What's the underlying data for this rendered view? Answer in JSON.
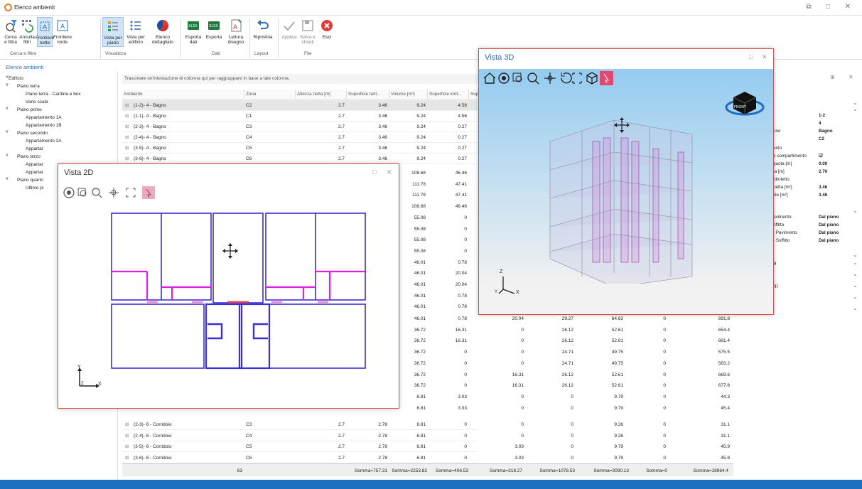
{
  "app": {
    "title": "Elenco ambienti"
  },
  "ribbon": {
    "buttons": [
      {
        "label": "Cerca e filtra",
        "icon": "search-filter-icon"
      },
      {
        "label": "Annulla filtri",
        "icon": "clear-filter-icon"
      },
      {
        "label": "Frontiere nette",
        "icon": "net-boundary-icon"
      },
      {
        "label": "Frontiere lorde",
        "icon": "gross-boundary-icon"
      },
      {
        "label": "Vista per piano",
        "icon": "floor-view-icon"
      },
      {
        "label": "Vista per edificio",
        "icon": "building-view-icon"
      },
      {
        "label": "Elenco dettagliato",
        "icon": "pie-chart-icon"
      },
      {
        "label": "Esporta dati",
        "icon": "xlsx-icon"
      },
      {
        "label": "Esporta",
        "icon": "xlsx-icon"
      },
      {
        "label": "Lettura disegno",
        "icon": "drawing-read-icon"
      },
      {
        "label": "Ripristina",
        "icon": "undo-icon"
      },
      {
        "label": "Applica",
        "icon": "check-icon"
      },
      {
        "label": "Salva e chiudi",
        "icon": "save-close-icon"
      },
      {
        "label": "Esci",
        "icon": "exit-icon"
      }
    ],
    "groups": [
      "Cerca e filtra",
      "Visualizza",
      "Dati",
      "Layout",
      "File"
    ]
  },
  "left_panel": {
    "title": "Elenco ambienti"
  },
  "tree": [
    {
      "label": "Edificio",
      "level": 0,
      "exp": "v"
    },
    {
      "label": "Piano terra",
      "level": 1,
      "exp": "v"
    },
    {
      "label": "Piano terra - Cantine e box",
      "level": 2
    },
    {
      "label": "Vano scala",
      "level": 2
    },
    {
      "label": "Piano primo",
      "level": 1,
      "exp": "v"
    },
    {
      "label": "Appartamento 1A",
      "level": 2
    },
    {
      "label": "Appartamento 1B",
      "level": 2
    },
    {
      "label": "Piano secondo",
      "level": 1,
      "exp": "v"
    },
    {
      "label": "Appartamento 2A",
      "level": 2
    },
    {
      "label": "Appartar",
      "level": 2
    },
    {
      "label": "Piano terzo",
      "level": 1,
      "exp": "v"
    },
    {
      "label": "Appartar",
      "level": 2
    },
    {
      "label": "Appartar",
      "level": 2
    },
    {
      "label": "Piano quarto",
      "level": 1,
      "exp": "v"
    },
    {
      "label": "Ultimo pi",
      "level": 2
    }
  ],
  "grid": {
    "group_hint": "Trascinare un'intestazione di colonna qui per raggruppare in base a tale colonna.",
    "headers": [
      "Ambiente",
      "Zona",
      "Altezza netta [m]",
      "Superficie nett...",
      "Volume [m³]",
      "Superficie lord...",
      "Sup"
    ],
    "rows_top": [
      [
        "(1-2)- 4 - Bagno",
        "C2",
        "2.7",
        "3.46",
        "9.24",
        "4.56"
      ],
      [
        "(1-1)- 4 - Bagno",
        "C1",
        "2.7",
        "3.46",
        "9.24",
        "4.56"
      ],
      [
        "(2-3)- 4 - Bagno",
        "C3",
        "2.7",
        "3.46",
        "9.24",
        "0.27"
      ],
      [
        "(2-4)- 4 - Bagno",
        "C4",
        "2.7",
        "3.46",
        "9.24",
        "0.27"
      ],
      [
        "(3-5)- 4 - Bagno",
        "C5",
        "2.7",
        "3.46",
        "9.24",
        "0.27"
      ],
      [
        "(3-6)- 4 - Bagno",
        "C6",
        "2.7",
        "3.46",
        "9.24",
        "0.27"
      ]
    ],
    "rows_mid": [
      [
        "108.68",
        "46.46"
      ],
      [
        "111.78",
        "47.41"
      ],
      [
        "111.78",
        "47.41"
      ],
      [
        "108.68",
        "46.46"
      ],
      [
        "55.08",
        "0"
      ],
      [
        "55.08",
        "0"
      ],
      [
        "55.08",
        "0"
      ],
      [
        "55.08",
        "0"
      ],
      [
        "46.01",
        "0.78"
      ],
      [
        "46.01",
        "20.04"
      ],
      [
        "46.01",
        "20.04"
      ],
      [
        "46.01",
        "0.78"
      ],
      [
        "46.01",
        "0.78"
      ]
    ],
    "rows_wide": [
      [
        "46.01",
        "0.78",
        "20.04",
        "29.27",
        "64.62",
        "0",
        "691.8"
      ],
      [
        "36.72",
        "16.31",
        "0",
        "26.12",
        "52.61",
        "0",
        "654.4"
      ],
      [
        "36.72",
        "16.31",
        "0",
        "26.12",
        "52.61",
        "0",
        "681.4"
      ],
      [
        "36.72",
        "0",
        "0",
        "24.71",
        "49.75",
        "0",
        "575.5"
      ],
      [
        "36.72",
        "0",
        "0",
        "24.71",
        "49.75",
        "0",
        "583.2"
      ],
      [
        "36.72",
        "0",
        "16.31",
        "26.12",
        "52.61",
        "0",
        "669.6"
      ],
      [
        "36.72",
        "0",
        "16.31",
        "26.12",
        "52.61",
        "0",
        "677.8"
      ],
      [
        "6.81",
        "3.03",
        "0",
        "0",
        "9.79",
        "0",
        "44.3"
      ],
      [
        "6.81",
        "3.03",
        "0",
        "0",
        "9.79",
        "0",
        "45.4"
      ]
    ],
    "rows_bottom": [
      [
        "(2-3)- 6 - Corridoio",
        "C3",
        "2.7",
        "2.78",
        "6.81",
        "0",
        "0",
        "0",
        "9.26",
        "0",
        "31.1"
      ],
      [
        "(2-4)- 6 - Corridoio",
        "C4",
        "2.7",
        "2.78",
        "6.81",
        "0",
        "0",
        "0",
        "9.26",
        "0",
        "31.1"
      ],
      [
        "(3-5)- 6 - Corridoio",
        "C5",
        "2.7",
        "2.78",
        "6.81",
        "0",
        "3.03",
        "0",
        "9.79",
        "0",
        "45.9"
      ],
      [
        "(3-6)- 6 - Corridoio",
        "C6",
        "2.7",
        "2.78",
        "6.81",
        "0",
        "3.03",
        "0",
        "9.79",
        "0",
        "45.8"
      ]
    ],
    "footer": {
      "count": "63",
      "sums": [
        "Somma=757.31",
        "Somma=2253.82",
        "Somma=406.53",
        "Somma=318.27",
        "Somma=1078.53",
        "Somma=3090.13",
        "Somma=0",
        "Somma=18964.4"
      ]
    }
  },
  "vista2d": {
    "title": "Vista 2D",
    "axis_y": "Y",
    "axis_x": "X",
    "axis_z": "Z"
  },
  "vista3d": {
    "title": "Vista 3D",
    "axis_z": "Z",
    "axis_x": "X",
    "axis_y": "Y",
    "cube_label": "FRONT"
  },
  "props": {
    "rows": [
      {
        "label": "",
        "value": "1-2"
      },
      {
        "label": "",
        "value": "4"
      },
      {
        "label": "one",
        "value": "Bagno"
      },
      {
        "label": "",
        "value": "C2"
      },
      {
        "label": "ento",
        "value": ""
      },
      {
        "label": "e compartimento",
        "value": "☑"
      },
      {
        "label": "quota [m]",
        "value": "0.00"
      },
      {
        "label": "ta [m]",
        "value": "2.70"
      },
      {
        "label": "ottotetto",
        "value": ""
      },
      {
        "label": "netta [m²]",
        "value": "3.46"
      },
      {
        "label": "tile [m²]",
        "value": "3.46"
      },
      {
        "label": "avimento",
        "value": "Dal piano"
      },
      {
        "label": "offitto",
        "value": "Dal piano"
      },
      {
        "label": "- Pavimento",
        "value": "Dal piano"
      },
      {
        "label": "- Soffitto",
        "value": "Dal piano"
      }
    ],
    "sections": [
      "e",
      "ni"
    ]
  },
  "colors": {
    "accent": "#2f6fb0",
    "status": "#1d6fc0",
    "win_border": "#e04a4a",
    "wall_blue": "#3a2fd6",
    "wall_magenta": "#e020e0"
  }
}
